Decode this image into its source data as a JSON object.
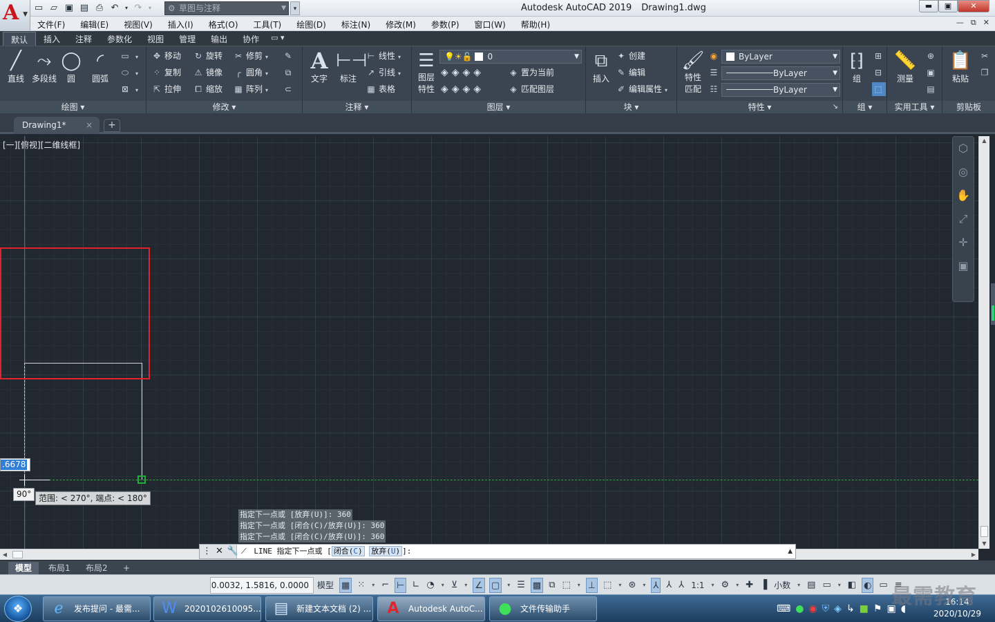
{
  "window": {
    "app_name": "Autodesk AutoCAD 2019",
    "file_name": "Drawing1.dwg",
    "workspace_placeholder": "草图与注释",
    "controls": {
      "minimize": "▬",
      "maximize": "▣",
      "close": "✕"
    }
  },
  "menu": {
    "items": [
      "文件(F)",
      "编辑(E)",
      "视图(V)",
      "插入(I)",
      "格式(O)",
      "工具(T)",
      "绘图(D)",
      "标注(N)",
      "修改(M)",
      "参数(P)",
      "窗口(W)",
      "帮助(H)"
    ],
    "doc_controls": [
      "—",
      "⧉",
      "✕"
    ]
  },
  "ribbon_tabs": [
    "默认",
    "插入",
    "注释",
    "参数化",
    "视图",
    "管理",
    "输出",
    "协作"
  ],
  "ribbon_tab_toggle": "▭ ▾",
  "ribbon": {
    "draw": {
      "title": "绘图 ▾",
      "line": "直线",
      "polyline": "多段线",
      "circle": "圆",
      "arc": "圆弧"
    },
    "modify": {
      "title": "修改 ▾",
      "move": "移动",
      "rotate": "旋转",
      "trim": "修剪",
      "copy": "复制",
      "mirror": "镜像",
      "fillet": "圆角",
      "stretch": "拉伸",
      "scale": "缩放",
      "array": "阵列"
    },
    "annotation": {
      "title": "注释 ▾",
      "text": "文字",
      "dimension": "标注",
      "linear": "线性",
      "leader": "引线",
      "table": "表格"
    },
    "layers": {
      "title": "图层 ▾",
      "layer_props_line1": "图层",
      "layer_props_line2": "特性",
      "layer_name": "0",
      "make_current": "置为当前",
      "match_layer": "匹配图层"
    },
    "block": {
      "title": "块 ▾",
      "insert": "插入",
      "create": "创建",
      "edit": "编辑",
      "edit_attr": "编辑属性"
    },
    "properties": {
      "title": "特性 ▾",
      "match_line1": "特性",
      "match_line2": "匹配",
      "color": "ByLayer",
      "linetype": "ByLayer",
      "lineweight": "ByLayer",
      "launcher": "↘"
    },
    "groups": {
      "title": "组 ▾",
      "group": "组"
    },
    "utilities": {
      "title": "实用工具 ▾",
      "measure": "测量"
    },
    "clipboard": {
      "title": "剪贴板",
      "paste": "粘贴"
    }
  },
  "file_tabs": {
    "doc": "Drawing1*",
    "close": "×",
    "new": "+"
  },
  "viewport": {
    "label": "[一][俯视][二维线框]",
    "dynamic_input_value": ".6678",
    "angle_tooltip": "90°",
    "polar_tooltip": "范围: < 270°, 端点: < 180°"
  },
  "command": {
    "history": [
      "指定下一点或 [放弃(U)]: 360",
      "指定下一点或 [闭合(C)/放弃(U)]: 360",
      "指定下一点或 [闭合(C)/放弃(U)]: 360"
    ],
    "grip_icons": "⋮✕🔧",
    "cmd_icon": "⟋",
    "cmd_name": "LINE",
    "prompt": "指定下一点或 [",
    "opt1": "闭合(",
    "opt1_key": "C",
    "opt1_end": ")",
    "opt2": "放弃(",
    "opt2_key": "U",
    "opt2_end": ")",
    "prompt_end": "]:",
    "expand": "▲"
  },
  "layout_tabs": {
    "model": "模型",
    "layout1": "布局1",
    "layout2": "布局2",
    "add": "+"
  },
  "status": {
    "coords": "0.0032, 1.5816, 0.0000",
    "model": "模型",
    "scale": "1:1",
    "units": "小数"
  },
  "taskbar": {
    "items": [
      "发布提问 - 最需...",
      "2020102610095...",
      "新建文本文档 (2) ...",
      "Autodesk AutoC...",
      "文件传输助手"
    ],
    "time": "16:14",
    "date": "2020/10/29"
  },
  "watermark": "最需教育"
}
